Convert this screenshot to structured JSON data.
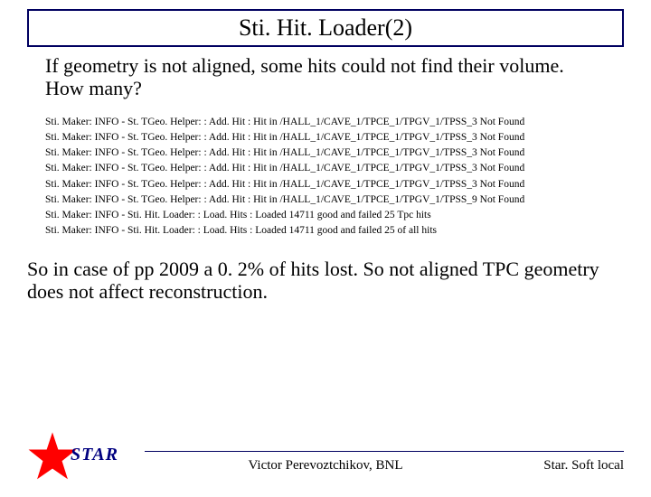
{
  "title": "Sti. Hit. Loader(2)",
  "intro": "If geometry is not aligned, some hits could not find their volume. How many?",
  "log_lines": [
    "Sti. Maker: INFO  - St. TGeo. Helper: : Add. Hit : Hit in /HALL_1/CAVE_1/TPCE_1/TPGV_1/TPSS_3 Not Found",
    "Sti. Maker: INFO  - St. TGeo. Helper: : Add. Hit : Hit in /HALL_1/CAVE_1/TPCE_1/TPGV_1/TPSS_3 Not Found",
    "Sti. Maker: INFO  - St. TGeo. Helper: : Add. Hit : Hit in /HALL_1/CAVE_1/TPCE_1/TPGV_1/TPSS_3 Not Found",
    "Sti. Maker: INFO  - St. TGeo. Helper: : Add. Hit : Hit in /HALL_1/CAVE_1/TPCE_1/TPGV_1/TPSS_3 Not Found",
    "Sti. Maker: INFO  - St. TGeo. Helper: : Add. Hit : Hit in /HALL_1/CAVE_1/TPCE_1/TPGV_1/TPSS_3 Not Found",
    "Sti. Maker: INFO  - St. TGeo. Helper: : Add. Hit : Hit in /HALL_1/CAVE_1/TPCE_1/TPGV_1/TPSS_9 Not Found",
    "Sti. Maker: INFO  - Sti. Hit. Loader: : Load. Hits : Loaded  14711 good and failed 25 Tpc hits",
    "Sti. Maker: INFO  - Sti. Hit. Loader: : Load. Hits : Loaded 14711 good and failed 25 of all hits"
  ],
  "conclusion": "So in case of pp 2009 a 0. 2% of hits lost. So not aligned TPC geometry does not affect reconstruction.",
  "footer": {
    "author": "Victor Perevoztchikov, BNL",
    "right": "Star. Soft local",
    "logo_text": "STAR"
  },
  "colors": {
    "border": "#000060",
    "logo_fill": "#ff0000",
    "logo_text": "#000080"
  }
}
